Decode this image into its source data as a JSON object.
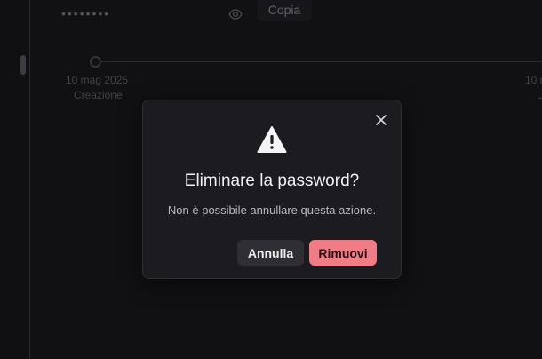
{
  "field": {
    "password_mask": "••••••••",
    "copy_label": "Copia"
  },
  "timeline": {
    "events": [
      {
        "date": "10 mag 2025",
        "label": "Creazione"
      },
      {
        "date": "10 r",
        "label": "U"
      }
    ]
  },
  "dialog": {
    "title": "Eliminare la password?",
    "message": "Non è possibile annullare questa azione.",
    "cancel_label": "Annulla",
    "confirm_label": "Rimuovi",
    "icons": {
      "warning": "warning-icon",
      "close": "close-icon"
    }
  },
  "colors": {
    "background": "#141416",
    "dialog_bg": "#1c1c20",
    "danger": "#f07c86",
    "secondary_button": "#2e2e34"
  }
}
